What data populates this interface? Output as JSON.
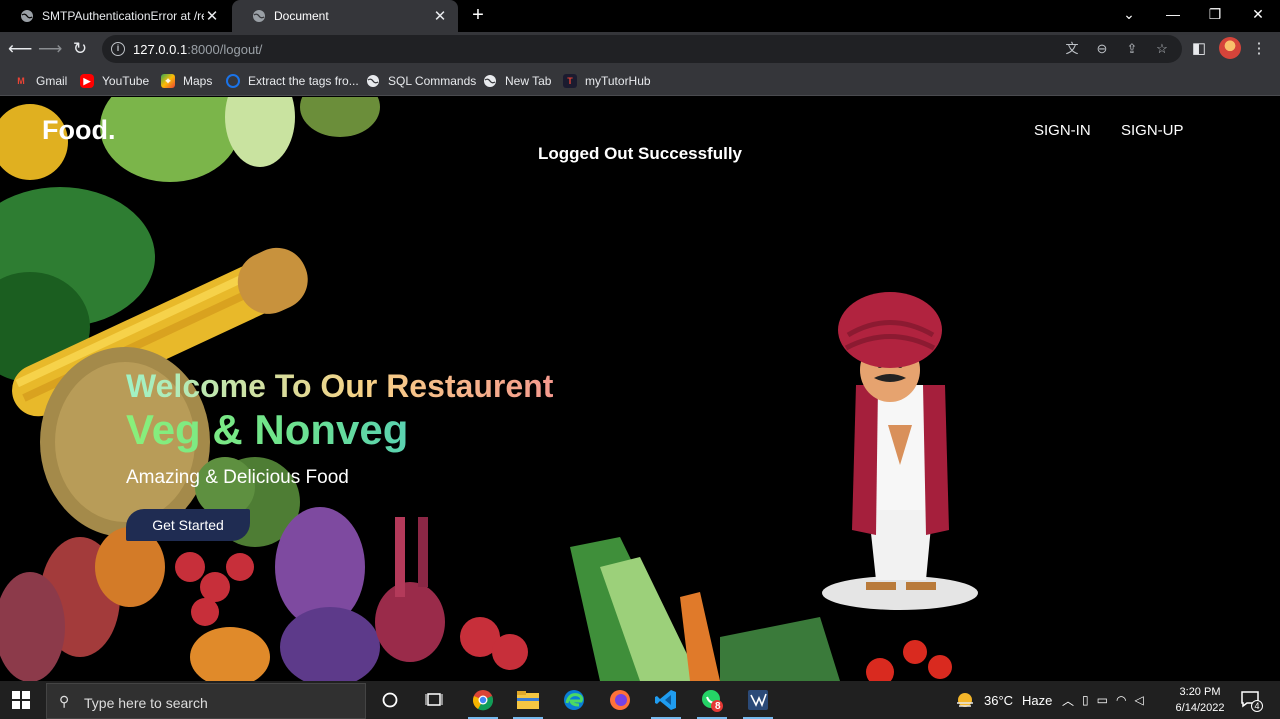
{
  "browser": {
    "tabs": [
      {
        "title": "SMTPAuthenticationError at /reg",
        "active": false
      },
      {
        "title": "Document",
        "active": true
      }
    ],
    "new_tab": "+",
    "window_controls": {
      "dropdown": "⌄",
      "minimize": "—",
      "restore": "❐",
      "close": "✕"
    },
    "url_host": "127.0.0.1",
    "url_rest": ":8000/logout/",
    "bookmarks": [
      {
        "label": "Gmail",
        "icon": "gmail-icon",
        "color": "#ea4335"
      },
      {
        "label": "YouTube",
        "icon": "youtube-icon",
        "color": "#ff0000"
      },
      {
        "label": "Maps",
        "icon": "maps-icon",
        "color": "#34a853"
      },
      {
        "label": "Extract the tags fro...",
        "icon": "site-icon",
        "color": "#1a73e8"
      },
      {
        "label": "SQL Commands",
        "icon": "globe-icon",
        "color": "#e8eaed"
      },
      {
        "label": "New Tab",
        "icon": "globe-icon",
        "color": "#e8eaed"
      },
      {
        "label": "myTutorHub",
        "icon": "mytutorhub-icon",
        "color": "#e34234"
      }
    ]
  },
  "site": {
    "brand": "Food.",
    "nav": {
      "signin": "SIGN-IN",
      "signup": "SIGN-UP"
    },
    "message": "Logged Out Successfully",
    "hero": {
      "welcome": "Welcome To Our Restaurent",
      "headline": "Veg & Nonveg",
      "tagline": "Amazing & Delicious Food",
      "cta": "Get Started"
    }
  },
  "taskbar": {
    "search_placeholder": "Type here to search",
    "whatsapp_badge": "8",
    "weather": {
      "temp": "36°C",
      "condition": "Haze"
    },
    "time": "3:20 PM",
    "date": "6/14/2022",
    "notifications": "4"
  }
}
